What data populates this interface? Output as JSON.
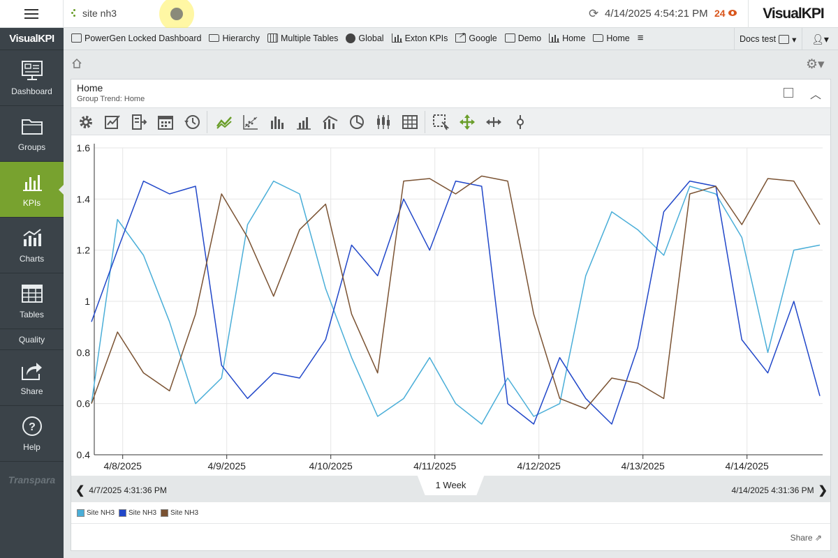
{
  "topbar": {
    "site_label": "site nh3",
    "datetime": "4/14/2025 4:54:21 PM",
    "alert_count": "24",
    "logo": "VisualKPI"
  },
  "sidebar": {
    "logo": "VisualKPI",
    "items": [
      {
        "label": "Dashboard",
        "icon": "dashboard-icon"
      },
      {
        "label": "Groups",
        "icon": "folder-icon"
      },
      {
        "label": "KPIs",
        "icon": "bar-chart-icon",
        "active": true
      },
      {
        "label": "Charts",
        "icon": "charts-icon"
      },
      {
        "label": "Tables",
        "icon": "table-icon"
      },
      {
        "label": "Quality"
      },
      {
        "label": "Share",
        "icon": "share-icon"
      },
      {
        "label": "Help",
        "icon": "help-icon"
      }
    ],
    "footer": "Transpara"
  },
  "navbar": {
    "links": [
      {
        "label": "PowerGen Locked Dashboard",
        "icon": "dashboard-icon"
      },
      {
        "label": "Hierarchy",
        "icon": "folder-icon"
      },
      {
        "label": "Multiple Tables",
        "icon": "table-icon"
      },
      {
        "label": "Global",
        "icon": "globe-icon"
      },
      {
        "label": "Exton KPIs",
        "icon": "bar-chart-icon"
      },
      {
        "label": "Google",
        "icon": "external-link-icon"
      },
      {
        "label": "Demo",
        "icon": "dashboard-icon"
      },
      {
        "label": "Home",
        "icon": "bar-chart-icon"
      },
      {
        "label": "Home",
        "icon": "folder-icon"
      }
    ],
    "docs_label": "Docs test"
  },
  "panel": {
    "title": "Home",
    "subtitle": "Group Trend: Home"
  },
  "timebar": {
    "start": "4/7/2025 4:31:36 PM",
    "end": "4/14/2025 4:31:36 PM",
    "range_label": "1 Week"
  },
  "legend": [
    "Site NH3",
    "Site NH3",
    "Site NH3"
  ],
  "share_label": "Share",
  "colors": {
    "accent": "#78a22f",
    "sidebar": "#3b4349",
    "series1": "#4aaed8",
    "series2": "#2147c9",
    "series3": "#7a5232",
    "alert": "#d9571e"
  },
  "chart_data": {
    "type": "line",
    "ylim": [
      0.4,
      1.6
    ],
    "yticks": [
      "0.4",
      "0.6",
      "0.8",
      "1",
      "1.2",
      "1.4",
      "1.6"
    ],
    "xticks": [
      "4/8/2025",
      "4/9/2025",
      "4/10/2025",
      "4/11/2025",
      "4/12/2025",
      "4/13/2025",
      "4/14/2025"
    ],
    "x_days": [
      0.0,
      0.25,
      0.5,
      0.75,
      1.0,
      1.25,
      1.5,
      1.75,
      2.0,
      2.25,
      2.5,
      2.75,
      3.0,
      3.25,
      3.5,
      3.75,
      4.0,
      4.25,
      4.5,
      4.75,
      5.0,
      5.25,
      5.5,
      5.75,
      6.0,
      6.25,
      6.5,
      6.75,
      7.0
    ],
    "series": [
      {
        "name": "Site NH3",
        "color": "#4aaed8",
        "values": [
          0.6,
          1.32,
          1.18,
          0.92,
          0.6,
          0.7,
          1.3,
          1.47,
          1.42,
          1.05,
          0.78,
          0.55,
          0.62,
          0.78,
          0.6,
          0.52,
          0.7,
          0.55,
          0.6,
          1.1,
          1.35,
          1.28,
          1.18,
          1.45,
          1.42,
          1.25,
          0.8,
          1.2,
          1.22
        ]
      },
      {
        "name": "Site NH3",
        "color": "#2147c9",
        "values": [
          0.92,
          1.2,
          1.47,
          1.42,
          1.45,
          0.75,
          0.62,
          0.72,
          0.7,
          0.85,
          1.22,
          1.1,
          1.4,
          1.2,
          1.47,
          1.45,
          0.6,
          0.52,
          0.78,
          0.62,
          0.52,
          0.82,
          1.35,
          1.47,
          1.45,
          0.85,
          0.72,
          1.0,
          0.63
        ]
      },
      {
        "name": "Site NH3",
        "color": "#7a5232",
        "values": [
          0.6,
          0.88,
          0.72,
          0.65,
          0.95,
          1.42,
          1.25,
          1.02,
          1.28,
          1.38,
          0.95,
          0.72,
          1.47,
          1.48,
          1.42,
          1.49,
          1.47,
          0.95,
          0.62,
          0.58,
          0.7,
          0.68,
          0.62,
          1.42,
          1.45,
          1.3,
          1.48,
          1.47,
          1.3
        ]
      }
    ]
  }
}
